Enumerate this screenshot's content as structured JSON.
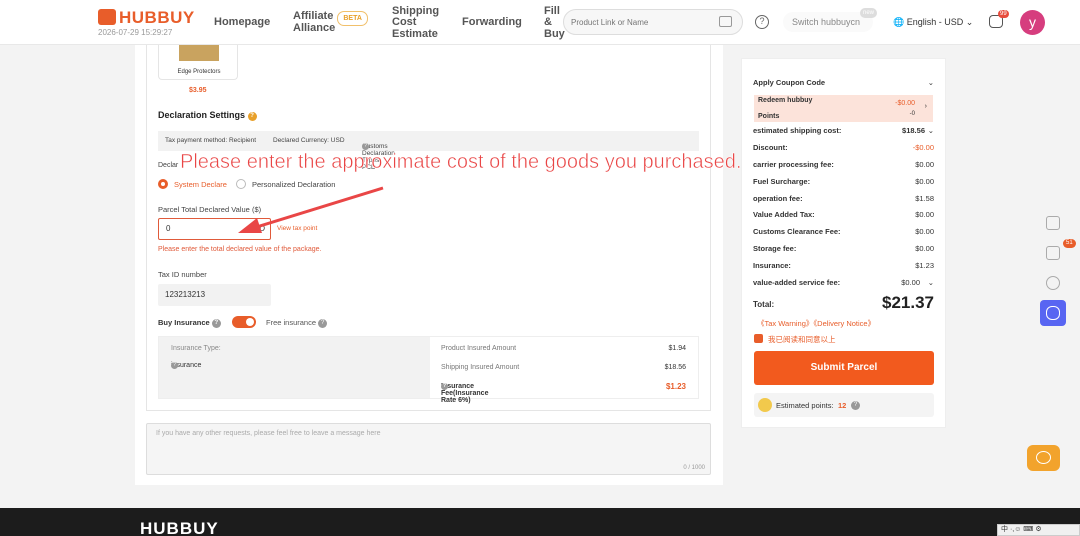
{
  "header": {
    "brand": "HUBBUY",
    "timestamp": "2026-07-29 15:29:27",
    "nav": {
      "homepage": "Homepage",
      "affiliate_1": "Affiliate",
      "affiliate_2": "Alliance",
      "beta": "BETA",
      "shipping_1": "Shipping",
      "shipping_2": "Cost",
      "shipping_3": "Estimate",
      "forwarding": "Forwarding",
      "fill_1": "Fill",
      "fill_2": "&",
      "fill_3": "Buy"
    },
    "search_placeholder": "Product Link or Name",
    "switch_label": "Switch hubbuycn",
    "switch_badge": "new",
    "lang": "English - USD",
    "msg_badge": "99",
    "avatar_letter": "y"
  },
  "product": {
    "name": "Edge Protectors",
    "price": "$3.95"
  },
  "declaration": {
    "title": "Declaration Settings",
    "tax_payment": "Tax payment method: Recipient",
    "currency": "Declared Currency: USD",
    "types": "Customs Declaration Types: PCD",
    "method_label": "Declar",
    "option_system": "System Declare",
    "option_personal": "Personalized Declaration",
    "value_label": "Parcel Total Declared Value ($)",
    "value": "0",
    "value_unit": "D",
    "view_tax": "View tax point",
    "error": "Please enter the total declared value of the package.",
    "tax_id_label": "Tax ID number",
    "tax_id": "123213213"
  },
  "annotation": "Please enter the approximate cost of the goods you purchased.",
  "insurance": {
    "buy_label": "Buy Insurance",
    "free_label": "Free insurance",
    "type_label": "Insurance Type:",
    "type_value": "insurance",
    "product_amount_label": "Product Insured Amount",
    "product_amount": "$1.94",
    "shipping_amount_label": "Shipping Insured Amount",
    "shipping_amount": "$18.56",
    "fee_label": "Insurance Fee(Insurance Rate 6%)",
    "fee": "$1.23"
  },
  "message": {
    "placeholder": "If you have any other requests, please feel free to leave a message here",
    "counter": "0 / 1000"
  },
  "summary": {
    "coupon": "Apply Coupon Code",
    "redeem_1": "Redeem hubbuy",
    "redeem_2": "Points",
    "redeem_value": "-$0.00",
    "redeem_sub": "-0",
    "rows": [
      {
        "label": "estimated shipping cost:",
        "value": "$18.56"
      },
      {
        "label": "Discount:",
        "value": "-$0.00"
      },
      {
        "label": "carrier processing fee:",
        "value": "$0.00"
      },
      {
        "label": "Fuel Surcharge:",
        "value": "$0.00"
      },
      {
        "label": "operation fee:",
        "value": "$1.58"
      },
      {
        "label": "Value Added Tax:",
        "value": "$0.00"
      },
      {
        "label": "Customs Clearance Fee:",
        "value": "$0.00"
      },
      {
        "label": "Storage fee:",
        "value": "$0.00"
      },
      {
        "label": "Insurance:",
        "value": "$1.23"
      },
      {
        "label": "value-added service fee:",
        "value": "$0.00"
      }
    ],
    "total_label": "Total:",
    "total": "$21.37",
    "notices": "《Tax Warning》《Delivery Notice》",
    "agree": "我已阅读和同意以上",
    "submit": "Submit Parcel",
    "points_label": "Estimated points:",
    "points": "12"
  },
  "side_rail": {
    "cart_badge": "51"
  },
  "footer": {
    "brand": "HUBBUY",
    "ime": "中 ·,☺ ⌨ ⚙"
  },
  "colors": {
    "accent": "#f25a1e",
    "error": "#e05a3a"
  }
}
